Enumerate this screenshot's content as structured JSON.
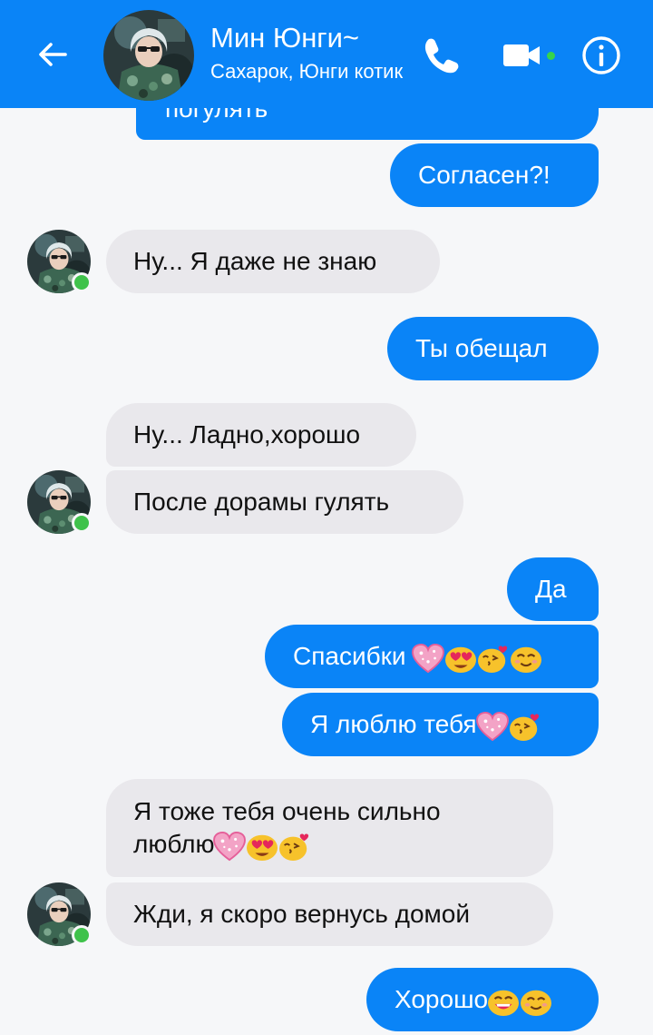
{
  "header": {
    "contact_name": "Мин Юнги~",
    "nicknames": "Сахарок, Юнги котик",
    "accent_color": "#0a84f7",
    "active_color": "#37d44c",
    "icons": [
      "back-arrow-icon",
      "phone-icon",
      "video-camera-icon",
      "info-icon"
    ]
  },
  "messages": [
    {
      "from": "me",
      "text": "погулять"
    },
    {
      "from": "me",
      "text": "Согласен?!"
    },
    {
      "from": "contact",
      "text": "Ну... Я даже не знаю"
    },
    {
      "from": "me",
      "text": "Ты обещал"
    },
    {
      "from": "contact",
      "text": "Ну... Ладно,хорошо"
    },
    {
      "from": "contact",
      "text": "После дорамы гулять"
    },
    {
      "from": "me",
      "text": "Да"
    },
    {
      "from": "me",
      "text": "Спасибки",
      "emoji": [
        "sparkling-heart",
        "heart-eyes",
        "kissing-heart",
        "smiling"
      ]
    },
    {
      "from": "me",
      "text": "Я люблю тебя",
      "emoji": [
        "sparkling-heart",
        "kissing-heart"
      ]
    },
    {
      "from": "contact",
      "text_line1": "Я тоже тебя очень сильно",
      "text_line2": "люблю",
      "emoji": [
        "sparkling-heart",
        "heart-eyes",
        "kissing-heart"
      ]
    },
    {
      "from": "contact",
      "text": "Жди, я скоро вернусь домой"
    },
    {
      "from": "me",
      "text": "Хорошо",
      "emoji": [
        "grinning",
        "smiling"
      ]
    }
  ]
}
